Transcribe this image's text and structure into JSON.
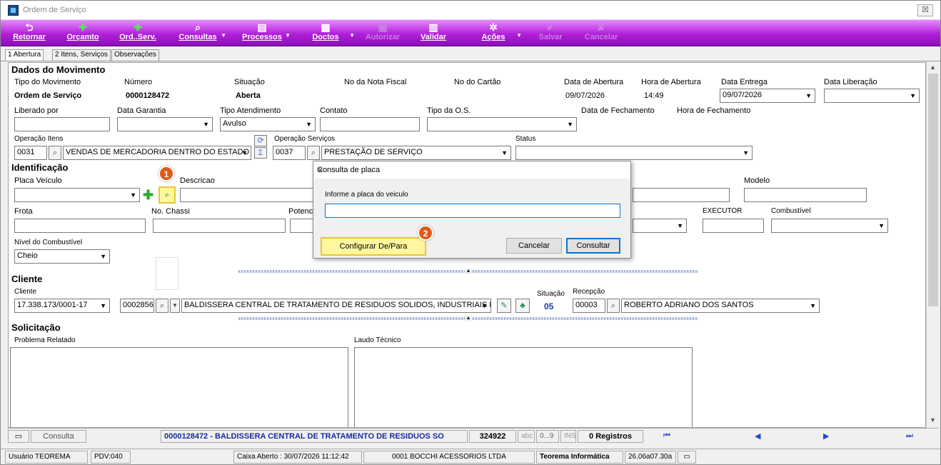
{
  "window": {
    "title": "Ordem de Serviço",
    "close": "☒"
  },
  "toolbar": {
    "retornar": "Retornar",
    "orcamento": "Orçamto",
    "ordserv": "Ord..Serv.",
    "consultas": "Consultas",
    "processos": "Processos",
    "doctos": "Doctos",
    "autorizar": "Autorizar",
    "validar": "Validar",
    "acoes": "Ações",
    "salvar": "Salvar",
    "cancelar": "Cancelar"
  },
  "tabs": [
    "1 Abertura",
    "2 Itens, Serviços",
    "Observações"
  ],
  "dados": {
    "title": "Dados do Movimento",
    "tipo_mov_label": "Tipo do Movimento",
    "tipo_mov": "Ordem de Serviço",
    "numero_label": "Número",
    "numero": "0000128472",
    "situacao_label": "Situação",
    "situacao": "Aberta",
    "nota_label": "No da Nota Fiscal",
    "cartao_label": "No do Cartão",
    "data_abertura_label": "Data de Abertura",
    "data_abertura": "09/07/2026",
    "hora_abertura_label": "Hora de Abertura",
    "hora_abertura": "14:49",
    "data_entrega_label": "Data Entrega",
    "data_entrega": "09/07/2026",
    "data_liberacao_label": "Data Liberação",
    "liberado_label": "Liberado por",
    "garantia_label": "Data Garantia",
    "tipo_atend_label": "Tipo Atendimento",
    "tipo_atend": "Avulso",
    "contato_label": "Contato",
    "tipo_os_label": "Tipo da O.S.",
    "data_fech_label": "Data de Fechamento",
    "hora_fech_label": "Hora de Fechamento",
    "op_itens_label": "Operação Itens",
    "op_itens_code": "0031",
    "op_itens": "VENDAS DE MERCADORIA DENTRO DO ESTADO",
    "op_serv_label": "Operação Serviços",
    "op_serv_code": "0037",
    "op_serv": "PRESTAÇÃO DE SERVIÇO",
    "status_label": "Status"
  },
  "ident": {
    "title": "Identificação",
    "placa_label": "Placa Veículo",
    "descricao_label": "Descricao",
    "modelo_label": "Modelo",
    "frota_label": "Frota",
    "chassi_label": "No. Chassi",
    "potencia_label": "Potenci",
    "executor_label": "EXECUTOR",
    "combustivel_label": "Combustível",
    "nivel_label": "Nível do Combustível",
    "nivel": "Cheio"
  },
  "cliente": {
    "title": "Cliente",
    "cliente_label": "Cliente",
    "cnpj": "17.338.173/0001-17",
    "codigo": "0002856",
    "nome": "BALDISSERA CENTRAL DE TRATAMENTO DE RESIDUOS SOLIDOS, INDUSTRIAIS E",
    "situacao_label": "Situação",
    "situacao": "05",
    "recepcao_label": "Recepção",
    "recepcao_code": "00003",
    "recepcao": "ROBERTO ADRIANO DOS SANTOS"
  },
  "solic": {
    "title": "Solicitação",
    "problema_label": "Problema Relatado",
    "laudo_label": "Laudo Técnico"
  },
  "dialog": {
    "title": "Consulta de placa",
    "prompt": "Informe a placa do veiculo",
    "value": "",
    "config": "Configurar De/Para",
    "cancel": "Cancelar",
    "ok": "Consultar"
  },
  "badges": {
    "b1": "1",
    "b2": "2"
  },
  "nav": {
    "consulta": "Consulta",
    "record": "0000128472 - BALDISSERA CENTRAL DE TRATAMENTO DE RESIDUOS SO",
    "id": "324922",
    "abc": "abc",
    "range": "0...9",
    "ins": "INS",
    "registros": "0 Registros"
  },
  "status": {
    "usuario": "Usuário TEOREMA",
    "pdv": "PDV:040",
    "caixa": "Caixa Aberto : 30/07/2026 11:12:42",
    "empresa": "0001 BOCCHI ACESSORIOS LTDA",
    "teorema": "Teorema Informática",
    "versao": "26.06a07.30a"
  },
  "colors": {
    "toolbar": "#b020d8",
    "highlight": "#fff7a0",
    "badge": "#e05a1a",
    "nav": "#1e4ad0"
  }
}
